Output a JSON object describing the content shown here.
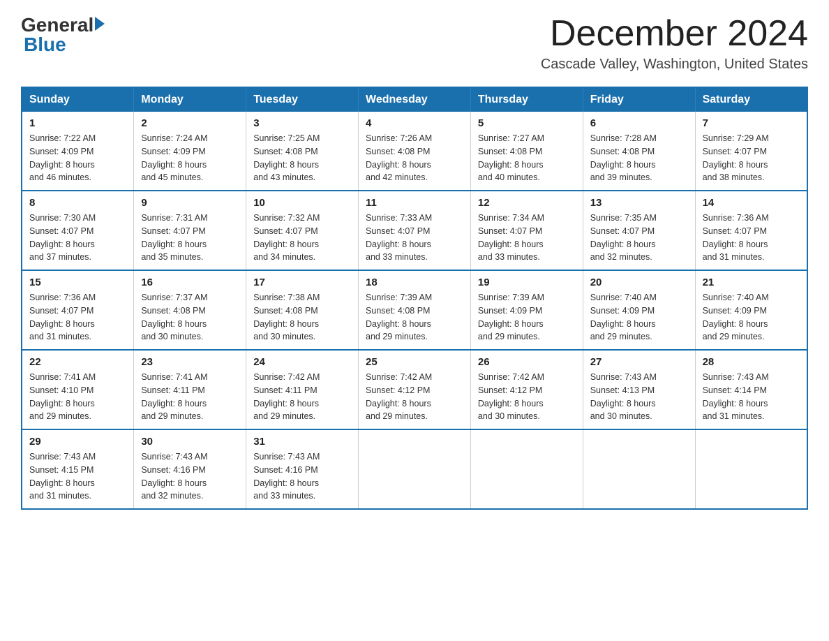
{
  "header": {
    "logo_general": "General",
    "logo_blue": "Blue",
    "month_title": "December 2024",
    "location": "Cascade Valley, Washington, United States"
  },
  "calendar": {
    "days_of_week": [
      "Sunday",
      "Monday",
      "Tuesday",
      "Wednesday",
      "Thursday",
      "Friday",
      "Saturday"
    ],
    "weeks": [
      [
        {
          "day": "1",
          "sunrise": "7:22 AM",
          "sunset": "4:09 PM",
          "daylight": "8 hours and 46 minutes."
        },
        {
          "day": "2",
          "sunrise": "7:24 AM",
          "sunset": "4:09 PM",
          "daylight": "8 hours and 45 minutes."
        },
        {
          "day": "3",
          "sunrise": "7:25 AM",
          "sunset": "4:08 PM",
          "daylight": "8 hours and 43 minutes."
        },
        {
          "day": "4",
          "sunrise": "7:26 AM",
          "sunset": "4:08 PM",
          "daylight": "8 hours and 42 minutes."
        },
        {
          "day": "5",
          "sunrise": "7:27 AM",
          "sunset": "4:08 PM",
          "daylight": "8 hours and 40 minutes."
        },
        {
          "day": "6",
          "sunrise": "7:28 AM",
          "sunset": "4:08 PM",
          "daylight": "8 hours and 39 minutes."
        },
        {
          "day": "7",
          "sunrise": "7:29 AM",
          "sunset": "4:07 PM",
          "daylight": "8 hours and 38 minutes."
        }
      ],
      [
        {
          "day": "8",
          "sunrise": "7:30 AM",
          "sunset": "4:07 PM",
          "daylight": "8 hours and 37 minutes."
        },
        {
          "day": "9",
          "sunrise": "7:31 AM",
          "sunset": "4:07 PM",
          "daylight": "8 hours and 35 minutes."
        },
        {
          "day": "10",
          "sunrise": "7:32 AM",
          "sunset": "4:07 PM",
          "daylight": "8 hours and 34 minutes."
        },
        {
          "day": "11",
          "sunrise": "7:33 AM",
          "sunset": "4:07 PM",
          "daylight": "8 hours and 33 minutes."
        },
        {
          "day": "12",
          "sunrise": "7:34 AM",
          "sunset": "4:07 PM",
          "daylight": "8 hours and 33 minutes."
        },
        {
          "day": "13",
          "sunrise": "7:35 AM",
          "sunset": "4:07 PM",
          "daylight": "8 hours and 32 minutes."
        },
        {
          "day": "14",
          "sunrise": "7:36 AM",
          "sunset": "4:07 PM",
          "daylight": "8 hours and 31 minutes."
        }
      ],
      [
        {
          "day": "15",
          "sunrise": "7:36 AM",
          "sunset": "4:07 PM",
          "daylight": "8 hours and 31 minutes."
        },
        {
          "day": "16",
          "sunrise": "7:37 AM",
          "sunset": "4:08 PM",
          "daylight": "8 hours and 30 minutes."
        },
        {
          "day": "17",
          "sunrise": "7:38 AM",
          "sunset": "4:08 PM",
          "daylight": "8 hours and 30 minutes."
        },
        {
          "day": "18",
          "sunrise": "7:39 AM",
          "sunset": "4:08 PM",
          "daylight": "8 hours and 29 minutes."
        },
        {
          "day": "19",
          "sunrise": "7:39 AM",
          "sunset": "4:09 PM",
          "daylight": "8 hours and 29 minutes."
        },
        {
          "day": "20",
          "sunrise": "7:40 AM",
          "sunset": "4:09 PM",
          "daylight": "8 hours and 29 minutes."
        },
        {
          "day": "21",
          "sunrise": "7:40 AM",
          "sunset": "4:09 PM",
          "daylight": "8 hours and 29 minutes."
        }
      ],
      [
        {
          "day": "22",
          "sunrise": "7:41 AM",
          "sunset": "4:10 PM",
          "daylight": "8 hours and 29 minutes."
        },
        {
          "day": "23",
          "sunrise": "7:41 AM",
          "sunset": "4:11 PM",
          "daylight": "8 hours and 29 minutes."
        },
        {
          "day": "24",
          "sunrise": "7:42 AM",
          "sunset": "4:11 PM",
          "daylight": "8 hours and 29 minutes."
        },
        {
          "day": "25",
          "sunrise": "7:42 AM",
          "sunset": "4:12 PM",
          "daylight": "8 hours and 29 minutes."
        },
        {
          "day": "26",
          "sunrise": "7:42 AM",
          "sunset": "4:12 PM",
          "daylight": "8 hours and 30 minutes."
        },
        {
          "day": "27",
          "sunrise": "7:43 AM",
          "sunset": "4:13 PM",
          "daylight": "8 hours and 30 minutes."
        },
        {
          "day": "28",
          "sunrise": "7:43 AM",
          "sunset": "4:14 PM",
          "daylight": "8 hours and 31 minutes."
        }
      ],
      [
        {
          "day": "29",
          "sunrise": "7:43 AM",
          "sunset": "4:15 PM",
          "daylight": "8 hours and 31 minutes."
        },
        {
          "day": "30",
          "sunrise": "7:43 AM",
          "sunset": "4:16 PM",
          "daylight": "8 hours and 32 minutes."
        },
        {
          "day": "31",
          "sunrise": "7:43 AM",
          "sunset": "4:16 PM",
          "daylight": "8 hours and 33 minutes."
        },
        null,
        null,
        null,
        null
      ]
    ],
    "labels": {
      "sunrise": "Sunrise:",
      "sunset": "Sunset:",
      "daylight": "Daylight:"
    }
  }
}
